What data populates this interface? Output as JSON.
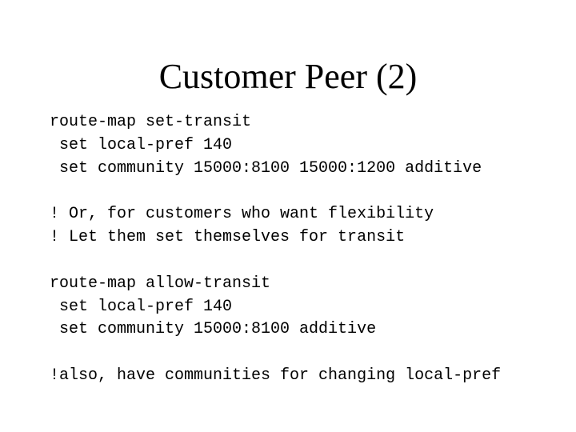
{
  "slide": {
    "title": "Customer Peer (2)",
    "lines": [
      "route-map set-transit",
      " set local-pref 140",
      " set community 15000:8100 15000:1200 additive",
      "",
      "! Or, for customers who want flexibility",
      "! Let them set themselves for transit",
      "",
      "route-map allow-transit",
      " set local-pref 140",
      " set community 15000:8100 additive",
      "",
      "!also, have communities for changing local-pref"
    ]
  }
}
